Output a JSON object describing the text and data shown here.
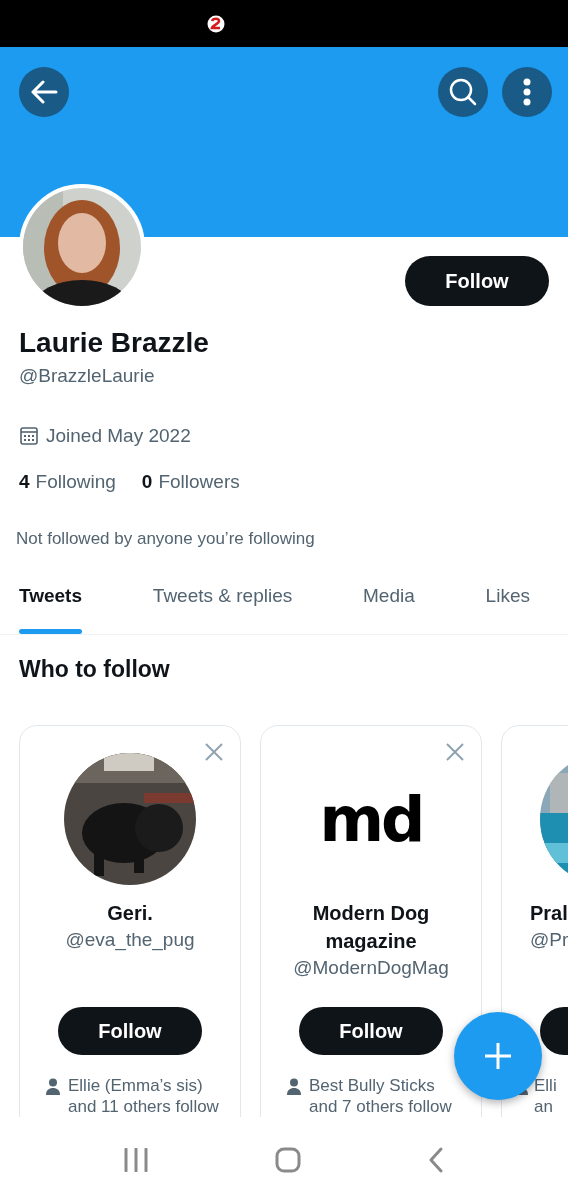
{
  "profile": {
    "follow_label": "Follow",
    "name": "Laurie Brazzle",
    "handle": "@BrazzleLaurie",
    "joined": "Joined May 2022",
    "stats": [
      {
        "count": "4",
        "label": "Following"
      },
      {
        "count": "0",
        "label": "Followers"
      }
    ],
    "followed_note": "Not followed by anyone you’re following"
  },
  "tabs": [
    {
      "label": "Tweets",
      "selected": true
    },
    {
      "label": "Tweets & replies",
      "selected": false
    },
    {
      "label": "Media",
      "selected": false
    },
    {
      "label": "Likes",
      "selected": false
    }
  ],
  "who_to_follow": {
    "title": "Who to follow",
    "cards": [
      {
        "name": "Geri.",
        "handle": "@eva_the_pug",
        "follow_label": "Follow",
        "followed_by": "Ellie (Emma’s sis) and 11 others follow"
      },
      {
        "kind": "logo",
        "logo_text": "md",
        "name": "Modern Dog magazine",
        "handle": "@ModernDogMag",
        "follow_label": "Follow",
        "followed_by": "Best Bully Sticks and 7 others follow"
      },
      {
        "kind": "cut",
        "name": "Pral",
        "handle": "@Pr",
        "followed_by": "Elli an"
      }
    ]
  }
}
